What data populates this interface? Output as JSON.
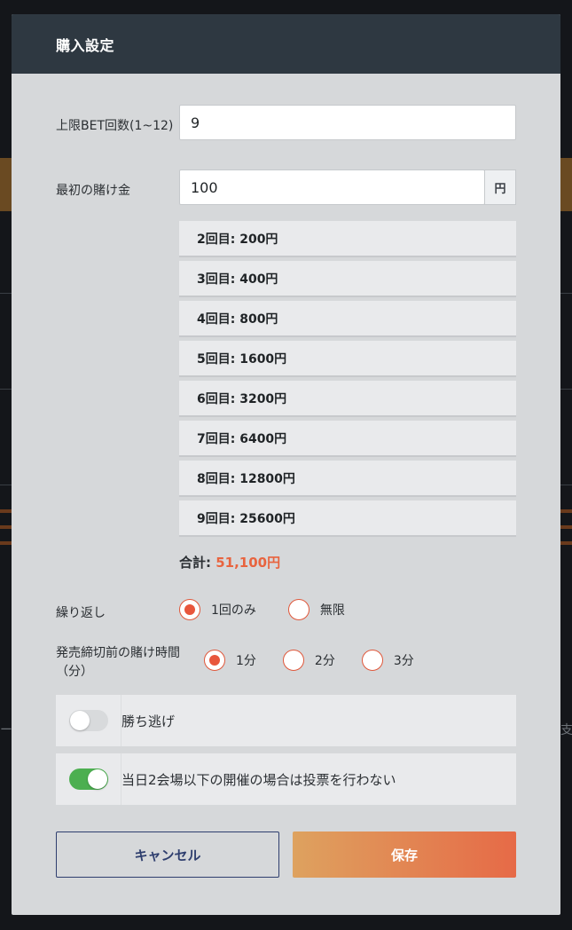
{
  "background": {
    "left_edge_text": "ー",
    "right_edge_text": "支"
  },
  "modal": {
    "title": "購入設定"
  },
  "max_bet": {
    "label": "上限BET回数(1~12)",
    "value": "9"
  },
  "first_bet": {
    "label": "最初の賭け金",
    "value": "100",
    "unit": "円"
  },
  "bet_steps": [
    "2回目: 200円",
    "3回目: 400円",
    "4回目: 800円",
    "5回目: 1600円",
    "6回目: 3200円",
    "7回目: 6400円",
    "8回目: 12800円",
    "9回目: 25600円"
  ],
  "total": {
    "label": "合計:",
    "amount": "51,100円"
  },
  "repeat": {
    "label": "繰り返し",
    "options": [
      "1回のみ",
      "無限"
    ],
    "selected": "1回のみ"
  },
  "bet_time": {
    "label_line1": "発売締切前の賭け時間",
    "label_line2": "（分）",
    "options": [
      "1分",
      "2分",
      "3分"
    ],
    "selected": "1分"
  },
  "toggles": {
    "win_escape": {
      "label": "勝ち逃げ",
      "on": false
    },
    "skip_small_days": {
      "label": "当日2会場以下の開催の場合は投票を行わない",
      "on": true
    }
  },
  "buttons": {
    "cancel": "キャンセル",
    "save": "保存"
  },
  "colors": {
    "accent": "#e8643f",
    "header": "#2e3841",
    "toggle_on": "#4caf50",
    "cancel_border": "#2e3e6e"
  }
}
